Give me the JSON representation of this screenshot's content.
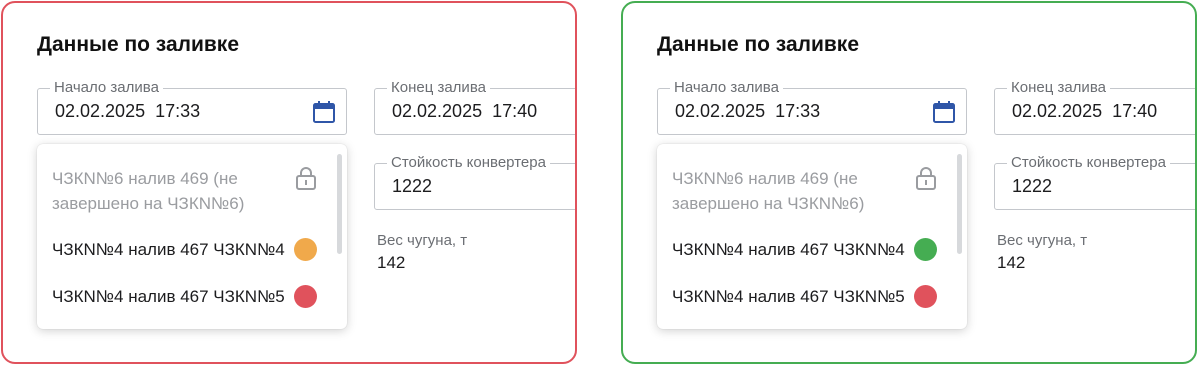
{
  "colors": {
    "orange": "#f0a94b",
    "red": "#e0525c",
    "green": "#45ad52"
  },
  "panels": [
    {
      "title": "Данные по заливке",
      "start_label": "Начало залива",
      "start_value": "02.02.2025  17:33",
      "end_label": "Конец залива",
      "end_value": "02.02.2025  17:40",
      "durability_label": "Стойкость конвертера",
      "durability_value": "1222",
      "weight_label": "Вес чугуна, т",
      "weight_value": "142",
      "options": [
        {
          "label": "ЧЗКN№6 налив 469 (не завершено на ЧЗКN№6)",
          "icon": "lock-icon"
        },
        {
          "label": "ЧЗКN№4 налив 467 ЧЗКN№4",
          "status_color": "#f0a94b"
        },
        {
          "label": "ЧЗКN№4 налив 467 ЧЗКN№5",
          "status_color": "#e0525c"
        }
      ]
    },
    {
      "title": "Данные по заливке",
      "start_label": "Начало залива",
      "start_value": "02.02.2025  17:33",
      "end_label": "Конец залива",
      "end_value": "02.02.2025  17:40",
      "durability_label": "Стойкость конвертера",
      "durability_value": "1222",
      "weight_label": "Вес чугуна, т",
      "weight_value": "142",
      "options": [
        {
          "label": "ЧЗКN№6 налив 469 (не завершено на ЧЗКN№6)",
          "icon": "lock-icon"
        },
        {
          "label": "ЧЗКN№4 налив 467 ЧЗКN№4",
          "status_color": "#45ad52"
        },
        {
          "label": "ЧЗКN№4 налив 467 ЧЗКN№5",
          "status_color": "#e0525c"
        }
      ]
    }
  ]
}
